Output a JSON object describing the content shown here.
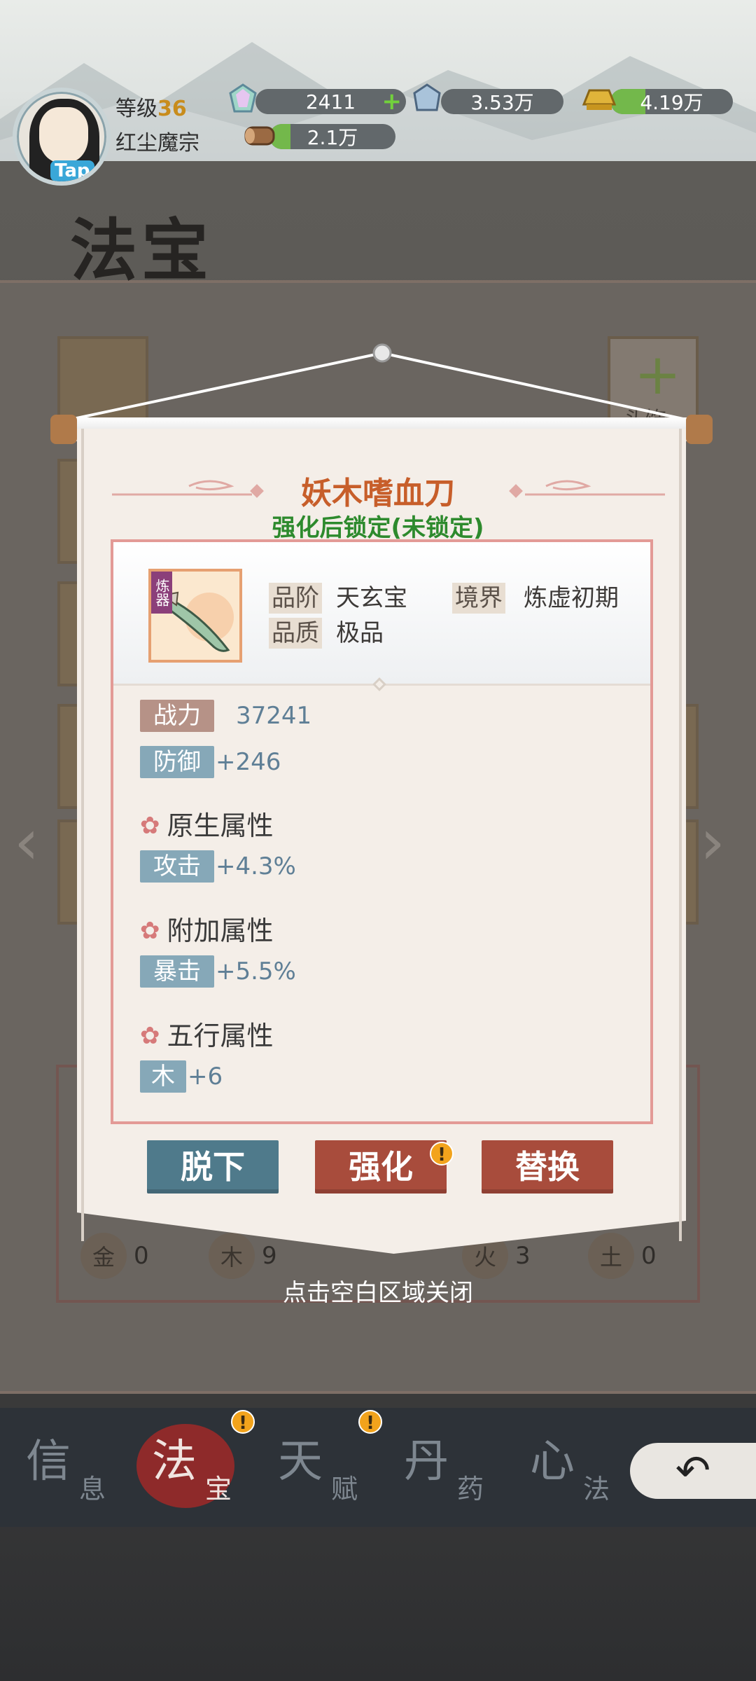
{
  "player": {
    "level_label": "等级",
    "level_value": "36",
    "sect": "红尘魔宗",
    "avatar_badge": "Tap"
  },
  "resources": [
    {
      "icon": "rainbow-crystal-icon",
      "value": "2411",
      "has_add": true
    },
    {
      "icon": "blue-crystal-icon",
      "value": "3.53万"
    },
    {
      "icon": "gold-ingot-icon",
      "value": "4.19万"
    },
    {
      "icon": "wood-log-icon",
      "value": "2.1万"
    }
  ],
  "background": {
    "page_title": "法宝",
    "bg_slot_right_label": "头饰",
    "elements": [
      {
        "glyph": "金",
        "count": "0"
      },
      {
        "glyph": "木",
        "count": "9"
      },
      {
        "glyph": "火",
        "count": "3"
      },
      {
        "glyph": "土",
        "count": "0"
      }
    ]
  },
  "modal": {
    "item_name": "妖木嗜血刀",
    "lock_status": "强化后锁定(未锁定)",
    "item_icon_tag": "炼器",
    "meta": {
      "rank_label": "品阶",
      "rank_value": "天玄宝",
      "realm_label": "境界",
      "realm_value": "炼虚初期",
      "quality_label": "品质",
      "quality_value": "极品"
    },
    "power_label": "战力",
    "power_value": "37241",
    "base_stat_label": "防御",
    "base_stat_value": "+246",
    "native_section": "原生属性",
    "native_label": "攻击",
    "native_value": "+4.3%",
    "extra_section": "附加属性",
    "extra_label": "暴击",
    "extra_value": "+5.5%",
    "five_section": "五行属性",
    "five_label": "木",
    "five_value": "+6",
    "buttons": {
      "remove": "脱下",
      "enhance": "强化",
      "replace": "替换"
    },
    "close_hint": "点击空白区域关闭"
  },
  "tabs": [
    {
      "big": "信",
      "small": "息"
    },
    {
      "big": "法",
      "small": "宝"
    },
    {
      "big": "天",
      "small": "赋"
    },
    {
      "big": "丹",
      "small": "药"
    },
    {
      "big": "心",
      "small": "法"
    }
  ],
  "colors": {
    "title_orange": "#c75e2a",
    "lock_green": "#2d8a2d",
    "button_blue": "#4f7a8b",
    "button_red": "#a84c3c"
  }
}
